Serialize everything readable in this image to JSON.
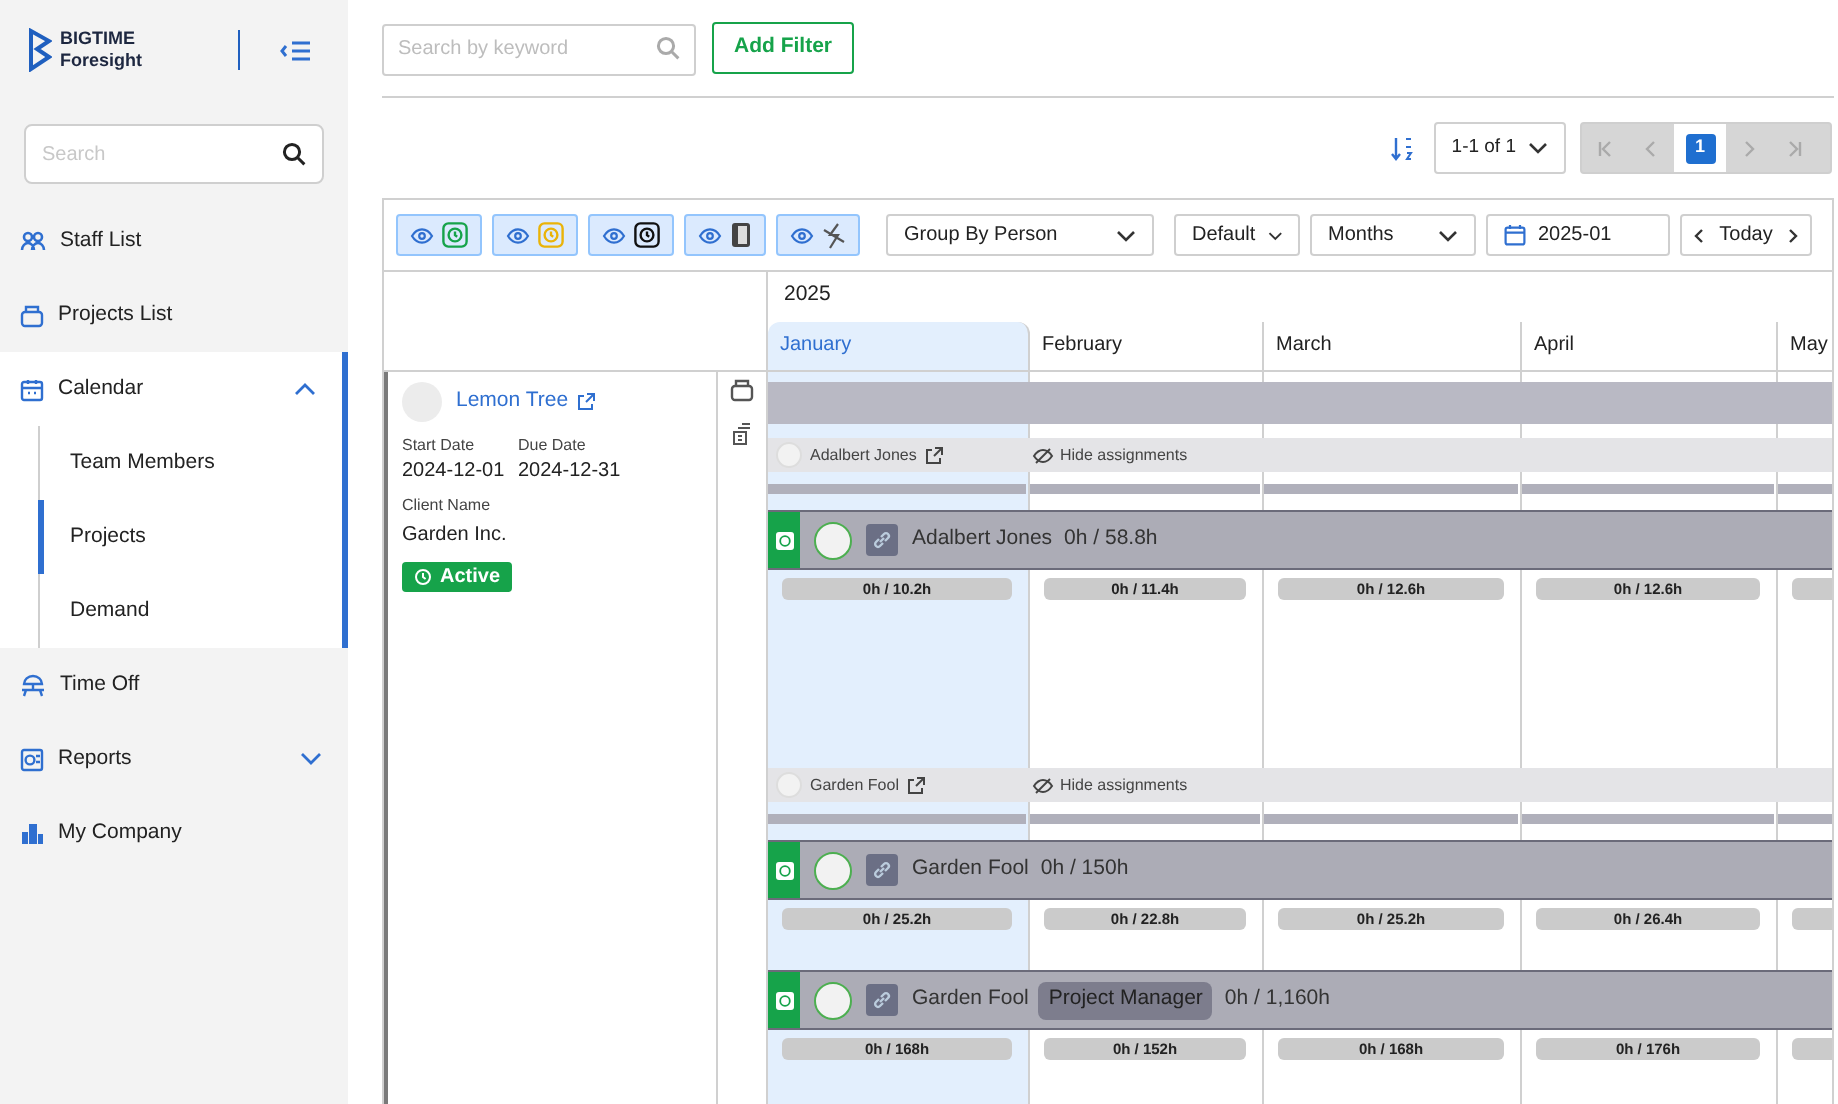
{
  "sidebar": {
    "logo": {
      "line1": "BIGTIME",
      "line2": "Foresight"
    },
    "search": {
      "placeholder": "Search"
    },
    "items": [
      {
        "label": "Staff List",
        "kind": "staff",
        "selected": false
      },
      {
        "label": "Projects List",
        "kind": "projects",
        "selected": false
      },
      {
        "label": "Calendar",
        "kind": "calendar",
        "selected": false,
        "expanded": true,
        "children": [
          {
            "label": "Team Members",
            "selected": false
          },
          {
            "label": "Projects",
            "selected": true
          },
          {
            "label": "Demand",
            "selected": false
          }
        ]
      },
      {
        "label": "Time Off",
        "kind": "timeoff",
        "selected": false
      },
      {
        "label": "Reports",
        "kind": "reports",
        "selected": false,
        "expanded": false
      },
      {
        "label": "My Company",
        "kind": "company",
        "selected": false
      }
    ]
  },
  "filter_bar": {
    "search": {
      "placeholder": "Search by keyword"
    },
    "add_filter": "Add Filter"
  },
  "pager": {
    "range": "1-1 of 1",
    "page": "1"
  },
  "toolbar": {
    "toggles": [
      {
        "kind": "clock",
        "color": "#16a34a",
        "on": true
      },
      {
        "kind": "clock",
        "color": "#eab308",
        "on": true
      },
      {
        "kind": "clock",
        "color": "#111111",
        "on": true
      },
      {
        "kind": "book",
        "on": true
      },
      {
        "kind": "unlink",
        "on": true
      }
    ],
    "group_by": "Group By Person",
    "sort": "Default",
    "scale": "Months",
    "date": "2025-01",
    "today": "Today"
  },
  "calendar": {
    "year": "2025",
    "months": [
      {
        "label": "January",
        "selected": true
      },
      {
        "label": "February",
        "selected": false
      },
      {
        "label": "March",
        "selected": false
      },
      {
        "label": "April",
        "selected": false
      },
      {
        "label": "May",
        "selected": false
      }
    ],
    "project": {
      "name": "Lemon Tree",
      "start_label": "Start Date",
      "start": "2024-12-01",
      "due_label": "Due Date",
      "due": "2024-12-31",
      "client_label": "Client Name",
      "client": "Garden Inc.",
      "status": "Active"
    },
    "groups": [
      {
        "person": "Adalbert Jones",
        "hide_label": "Hide assignments",
        "assignments": [
          {
            "name": "Adalbert Jones",
            "total": "0h / 58.8h",
            "hours": [
              "0h / 10.2h",
              "0h / 11.4h",
              "0h / 12.6h",
              "0h / 12.6h"
            ]
          }
        ]
      },
      {
        "person": "Garden Fool",
        "hide_label": "Hide assignments",
        "assignments": [
          {
            "name": "Garden Fool",
            "total": "0h / 150h",
            "hours": [
              "0h / 25.2h",
              "0h / 22.8h",
              "0h / 25.2h",
              "0h / 26.4h"
            ]
          },
          {
            "name": "Garden Fool",
            "role": "Project Manager",
            "total": "0h / 1,160h",
            "hours": [
              "0h / 168h",
              "0h / 152h",
              "0h / 168h",
              "0h / 176h"
            ]
          }
        ]
      }
    ]
  }
}
